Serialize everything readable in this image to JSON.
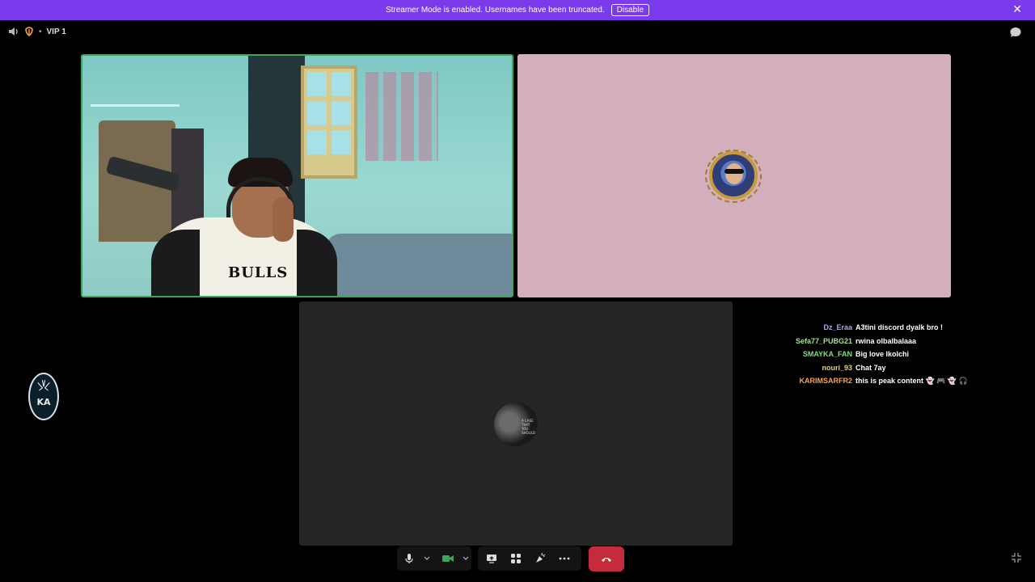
{
  "banner": {
    "text": "Streamer Mode is enabled. Usernames have been truncated.",
    "button_label": "Disable",
    "close_glyph": "✕"
  },
  "header": {
    "separator": "•",
    "title": "VIP 1"
  },
  "tiles": {
    "webcam_jersey_text": "BULLS",
    "avatar_bottom_text": "A CASE THAT YOU SHOULD"
  },
  "side_logo": {
    "text": "KA"
  },
  "chat": [
    {
      "user": "Dz_Eraa",
      "color": "#b59ef0",
      "message": "A3tini discord dyalk bro !"
    },
    {
      "user": "Sefa77_PUBG21",
      "color": "#a3e28b",
      "message": "rwina olbalbalaaa"
    },
    {
      "user": "SMAYKA_FAN",
      "color": "#7be07b",
      "message": "Big love lkolchi"
    },
    {
      "user": "nouri_93",
      "color": "#e8d26a",
      "message": "Chat 7ay"
    },
    {
      "user": "KARIMSARFR2",
      "color": "#f5a24a",
      "message": "this is peak content 👻 🎮 👻 🎧"
    }
  ],
  "colors": {
    "banner_bg": "#7c3aed",
    "speaking_border": "#3ba55c",
    "hangup": "#c42b3b",
    "camera_on": "#3ba55c"
  },
  "icons": [
    "speaker-icon",
    "channel-icon",
    "chat-bubble-icon",
    "close-icon",
    "microphone-icon",
    "chevron-down-icon",
    "camera-icon",
    "screen-share-icon",
    "activities-icon",
    "soundboard-icon",
    "more-icon",
    "hangup-icon",
    "collapse-icon"
  ]
}
